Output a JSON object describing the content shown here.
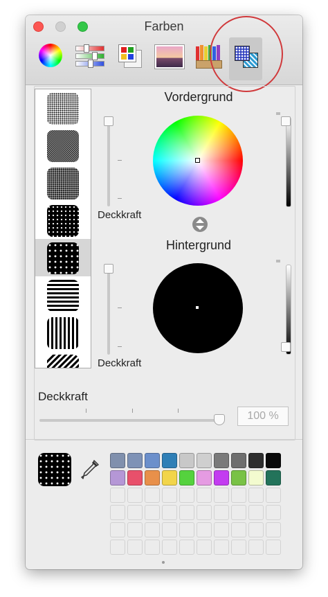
{
  "window": {
    "title": "Farben"
  },
  "toolbar": {
    "tabs": [
      {
        "name": "color-wheel"
      },
      {
        "name": "color-sliders"
      },
      {
        "name": "color-palettes"
      },
      {
        "name": "image-palettes"
      },
      {
        "name": "crayons"
      },
      {
        "name": "patterns",
        "selected": true
      }
    ]
  },
  "foreground": {
    "heading": "Vordergrund",
    "opacity_label": "Deckkraft"
  },
  "background": {
    "heading": "Hintergrund",
    "opacity_label": "Deckkraft"
  },
  "opacity": {
    "label": "Deckkraft",
    "value": "100 %",
    "level": 1.0
  },
  "patterns": [
    "dots-fine",
    "checker-fine",
    "dots-medium",
    "dots-sparse",
    "dots-large",
    "stripes-horizontal",
    "stripes-vertical",
    "stripes-diagonal"
  ],
  "selected_pattern_index": 4,
  "swatches": {
    "row1": [
      "#8090ad",
      "#7e92b6",
      "#6b8fcb",
      "#2f7fb6",
      "#c8c8c8",
      "#cfcfcf",
      "#7a7a7a",
      "#6e6e6e",
      "#2e2e2e",
      "#0a0a0a"
    ],
    "row2": [
      "#b597d6",
      "#e8506b",
      "#e8904a",
      "#f2d54a",
      "#55d23e",
      "#e59be2",
      "#c33cf0",
      "#79c246",
      "#f3fbcf",
      "#23735a"
    ],
    "empty_rows": 4
  },
  "colors": {
    "accent_annotation": "#d0393b",
    "close": "#fc5753",
    "minimize": "#d0d0d0",
    "zoom": "#33c748"
  }
}
